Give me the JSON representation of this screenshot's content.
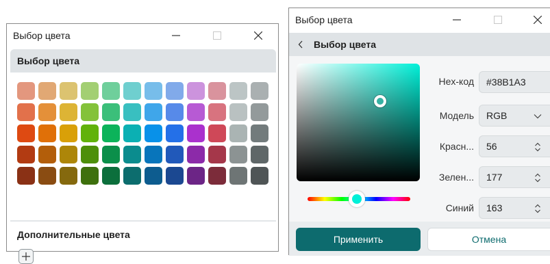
{
  "left_window": {
    "title": "Выбор цвета",
    "header": "Выбор цвета",
    "swatch_rows": [
      [
        "#e3977e",
        "#e1a874",
        "#dcc370",
        "#a3cf73",
        "#6fcf9b",
        "#6fcfcf",
        "#77bdea",
        "#81aaea",
        "#cc93dd",
        "#d9939d",
        "#bcc5c5",
        "#aab0b1"
      ],
      [
        "#e2714b",
        "#e49039",
        "#ddb435",
        "#84c23a",
        "#3bbf7a",
        "#39bfc0",
        "#3fa6ea",
        "#578ae9",
        "#b75ad4",
        "#d8737f",
        "#b9c1c1",
        "#939a9b"
      ],
      [
        "#de4a12",
        "#e07008",
        "#d9a008",
        "#61b20a",
        "#0cb35a",
        "#0bb0b3",
        "#0891e9",
        "#2470e8",
        "#aa31cd",
        "#cf4858",
        "#aab4b3",
        "#727b7c"
      ],
      [
        "#b23b12",
        "#b35e0a",
        "#ad8609",
        "#4d8f0a",
        "#0b8f4a",
        "#0b8c8e",
        "#0875bb",
        "#2159ba",
        "#8c2aa9",
        "#a5374a",
        "#8c9393",
        "#5f6768"
      ],
      [
        "#8a3115",
        "#8a4c12",
        "#85690e",
        "#3e700d",
        "#0c6f3c",
        "#0c6d6e",
        "#0d5c8f",
        "#1b4891",
        "#6c2586",
        "#7c2c3a",
        "#6e7575",
        "#4f5556"
      ]
    ],
    "additional_label": "Дополнительные цвета",
    "add_icon": "plus-icon"
  },
  "right_window": {
    "title": "Выбор цвета",
    "header": "Выбор цвета",
    "selected_color": "#38b1a3",
    "hue_color": "#00f0d8",
    "saturation": 0.68,
    "value": 0.68,
    "hue_fraction": 0.48,
    "fields": {
      "hex_label": "Hex-код",
      "hex_value": "#38B1A3",
      "model_label": "Модель",
      "model_value": "RGB",
      "red_label": "Красн...",
      "red_value": "56",
      "green_label": "Зелен...",
      "green_value": "177",
      "blue_label": "Синий",
      "blue_value": "163"
    },
    "apply_label": "Применить",
    "cancel_label": "Отмена",
    "accent_color": "#0d6b6e"
  }
}
